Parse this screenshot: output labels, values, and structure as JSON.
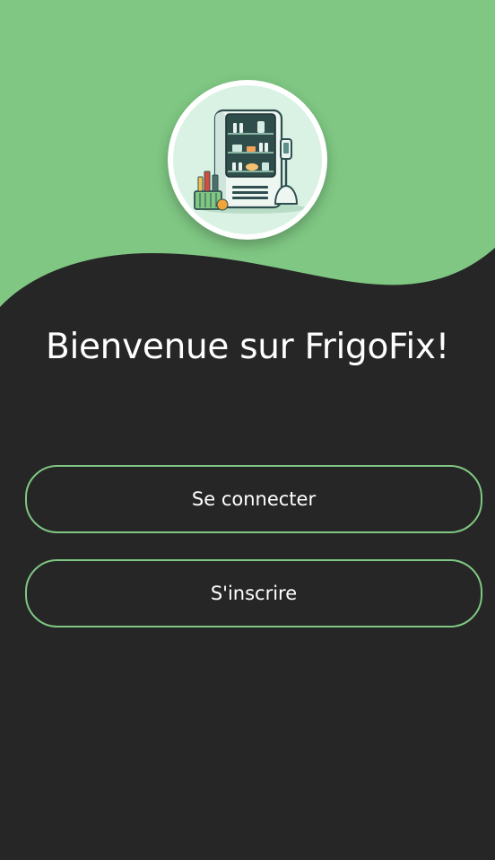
{
  "app": {
    "title": "Bienvenue sur FrigoFix!"
  },
  "logo": {
    "icon": "smart-fridge-icon"
  },
  "actions": {
    "login_label": "Se connecter",
    "signup_label": "S'inscrire"
  },
  "colors": {
    "accent": "#7fc783",
    "background": "#262626",
    "text": "#ffffff"
  }
}
